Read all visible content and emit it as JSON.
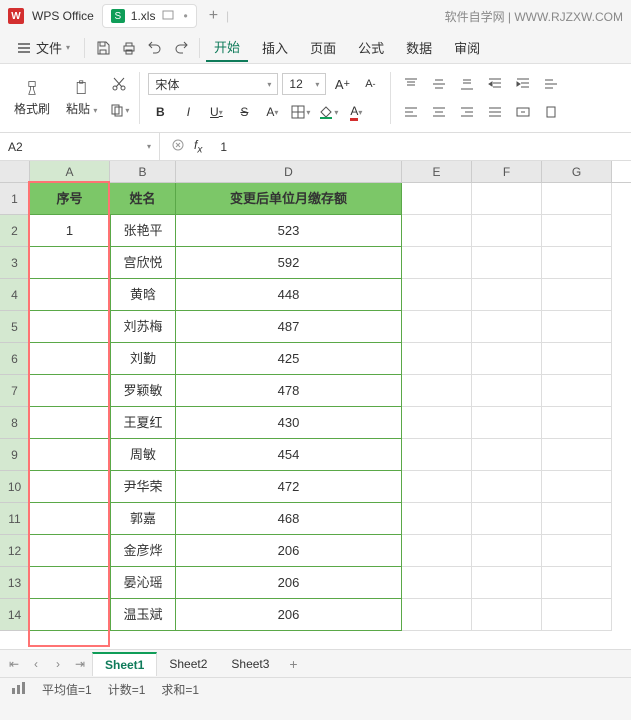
{
  "titlebar": {
    "app_name": "WPS Office",
    "file_name": "1.xls",
    "site_text": "软件自学网 | WWW.RJZXW.COM"
  },
  "menubar": {
    "file": "文件",
    "tabs": [
      "开始",
      "插入",
      "页面",
      "公式",
      "数据",
      "审阅"
    ],
    "active_index": 0
  },
  "ribbon": {
    "format_brush": "格式刷",
    "paste": "粘贴",
    "font_name": "宋体",
    "font_size": "12"
  },
  "formula_bar": {
    "name_box": "A2",
    "formula": "1"
  },
  "columns": [
    "A",
    "B",
    "D",
    "E",
    "F",
    "G"
  ],
  "header_row": {
    "A": "序号",
    "B": "姓名",
    "D": "变更后单位月缴存额"
  },
  "data_rows": [
    {
      "A": "1",
      "B": "张艳平",
      "D": "523"
    },
    {
      "A": "",
      "B": "宫欣悦",
      "D": "592"
    },
    {
      "A": "",
      "B": "黄晗",
      "D": "448"
    },
    {
      "A": "",
      "B": "刘苏梅",
      "D": "487"
    },
    {
      "A": "",
      "B": "刘勤",
      "D": "425"
    },
    {
      "A": "",
      "B": "罗颖敏",
      "D": "478"
    },
    {
      "A": "",
      "B": "王夏红",
      "D": "430"
    },
    {
      "A": "",
      "B": "周敏",
      "D": "454"
    },
    {
      "A": "",
      "B": "尹华荣",
      "D": "472"
    },
    {
      "A": "",
      "B": "郭嘉",
      "D": "468"
    },
    {
      "A": "",
      "B": "金彦烨",
      "D": "206"
    },
    {
      "A": "",
      "B": "晏沁瑶",
      "D": "206"
    },
    {
      "A": "",
      "B": "温玉斌",
      "D": "206"
    }
  ],
  "sheet_tabs": [
    "Sheet1",
    "Sheet2",
    "Sheet3"
  ],
  "active_sheet": 0,
  "status_bar": {
    "avg": "平均值=1",
    "count": "计数=1",
    "sum": "求和=1"
  }
}
